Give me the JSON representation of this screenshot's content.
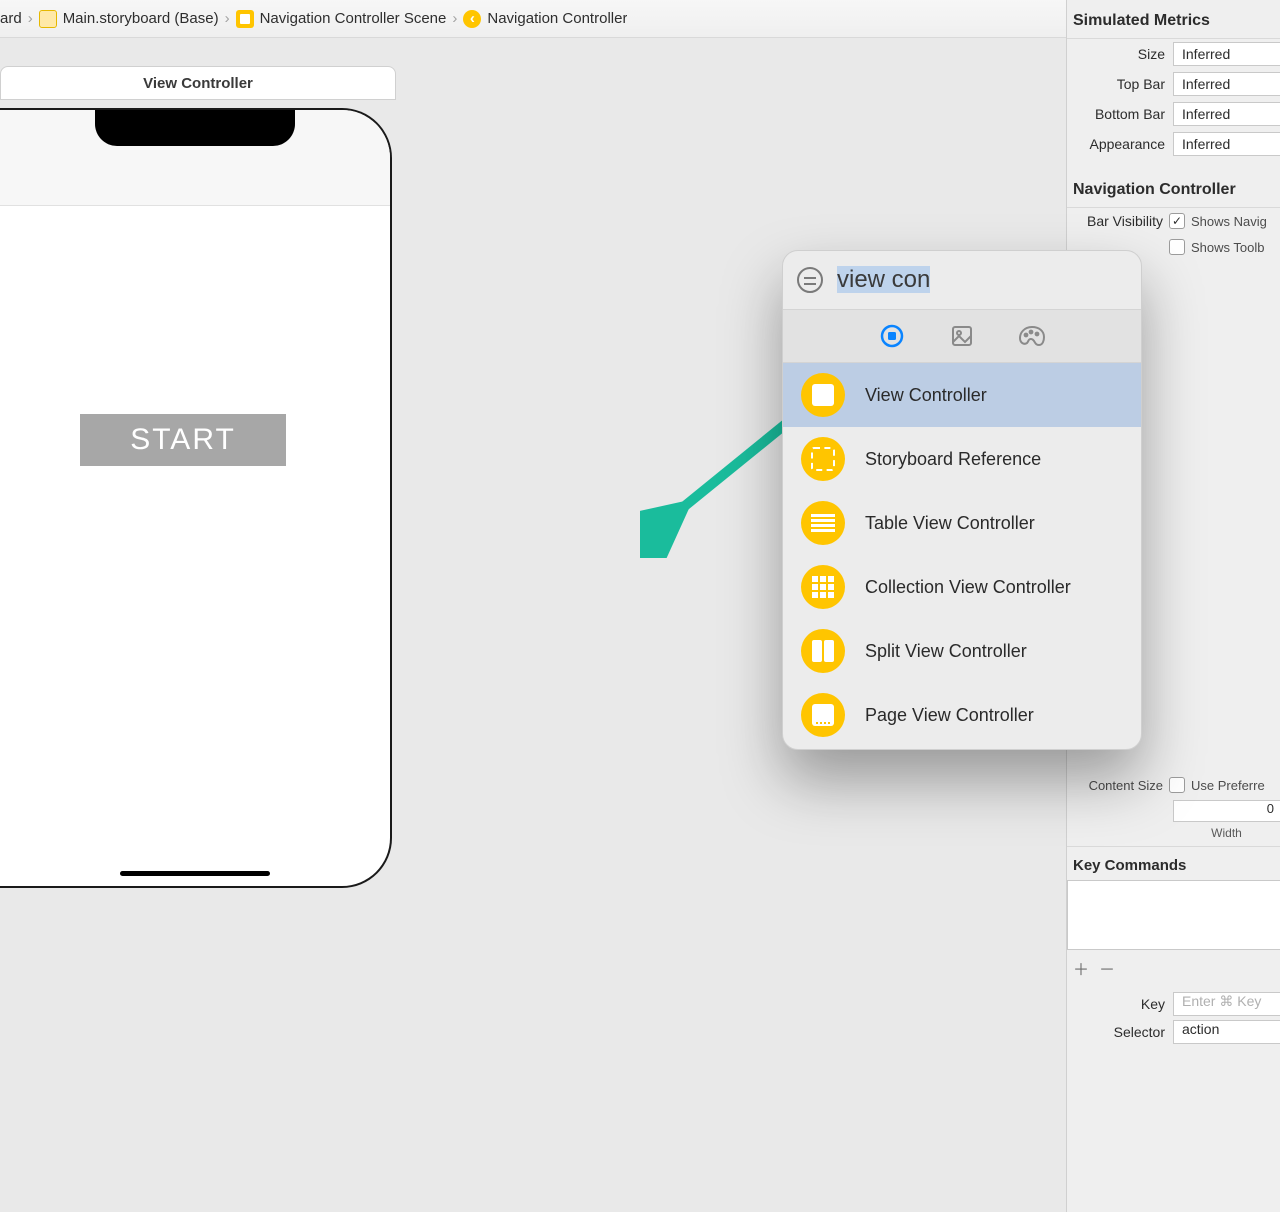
{
  "breadcrumb": {
    "seg0": "ard",
    "seg1": "Main.storyboard (Base)",
    "seg2": "Navigation Controller Scene",
    "seg3": "Navigation Controller"
  },
  "canvas": {
    "pill_title": "View Controller",
    "start_button_label": "START"
  },
  "inspector": {
    "simulated_header": "Simulated Metrics",
    "rows": {
      "size_label": "Size",
      "size_value": "Inferred",
      "topbar_label": "Top Bar",
      "topbar_value": "Inferred",
      "bottombar_label": "Bottom Bar",
      "bottombar_value": "Inferred",
      "appearance_label": "Appearance",
      "appearance_value": "Inferred"
    },
    "navctrl_header": "Navigation Controller",
    "barvis_label": "Bar Visibility",
    "showsnav": "Shows Navig",
    "showstool": "Shows Toolb",
    "content_size_label": "Content Size",
    "content_size_opt": "Use Preferre",
    "width_value": "0",
    "width_label": "Width",
    "keycmd_header": "Key Commands",
    "key_label": "Key",
    "key_placeholder": "Enter ⌘ Key",
    "selector_label": "Selector",
    "selector_value": "action"
  },
  "library": {
    "search_text": "view con",
    "items": [
      {
        "label": "View Controller"
      },
      {
        "label": "Storyboard Reference"
      },
      {
        "label": "Table View Controller"
      },
      {
        "label": "Collection View Controller"
      },
      {
        "label": "Split View Controller"
      },
      {
        "label": "Page View Controller"
      }
    ]
  }
}
